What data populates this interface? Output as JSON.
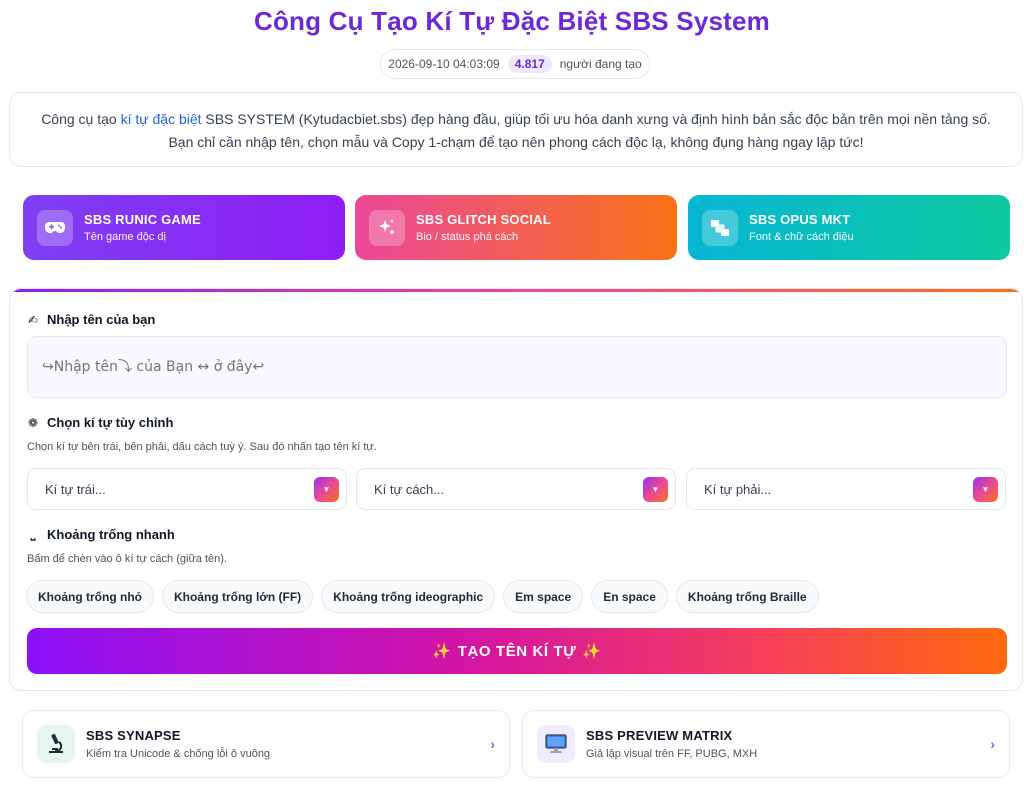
{
  "header": {
    "title": "Công Cụ Tạo Kí Tự Đặc Biệt SBS System",
    "timestamp": "2026-09-10 04:03:09",
    "user_count": "4.817",
    "user_suffix": "người đang tạo"
  },
  "intro": {
    "part1": "Công cụ tạo ",
    "link": "kí tự đặc biệt",
    "part2": " SBS SYSTEM (Kytudacbiet.sbs) đẹp hàng đầu, giúp tối ưu hóa danh xưng và định hình bản sắc độc bản trên mọi nền tảng số. Bạn chỉ cần nhập tên, chọn mẫu và Copy 1-chạm để tạo nên phong cách độc lạ, không đụng hàng ngay lập tức!"
  },
  "modes": [
    {
      "title": "SBS RUNIC GAME",
      "subtitle": "Tên game độc dị",
      "icon": "gamepad-icon"
    },
    {
      "title": "SBS GLITCH SOCIAL",
      "subtitle": "Bio / status phá cách",
      "icon": "sparkles-icon"
    },
    {
      "title": "SBS OPUS MKT",
      "subtitle": "Font & chữ cách điệu",
      "icon": "font-blocks-icon"
    }
  ],
  "form": {
    "name_label": "Nhập tên của bạn",
    "name_placeholder": "↪Nhập tên⤵ của Bạn ↔ ở đây↩",
    "custom_label": "Chọn kí tự tùy chỉnh",
    "custom_hint": "Chọn kí tự bên trái, bên phải, dấu cách tuỳ ý. Sau đó nhấn tạo tên kí tự.",
    "selects": [
      "Kí tự trái...",
      "Kí tự cách...",
      "Kí tự phải..."
    ],
    "space_label": "Khoảng trống nhanh",
    "space_hint": "Bấm để chèn vào ô kí tự cách (giữa tên).",
    "chips": [
      "Khoảng trống nhỏ",
      "Khoảng trống lớn (FF)",
      "Khoảng trống ideographic",
      "Em space",
      "En space",
      "Khoảng trống Braille"
    ],
    "generate_label": "TẠO TÊN KÍ TỰ"
  },
  "tools": [
    {
      "title": "SBS SYNAPSE",
      "subtitle": "Kiểm tra Unicode & chống lỗi ô vuông",
      "icon": "microscope-icon"
    },
    {
      "title": "SBS PREVIEW MATRIX",
      "subtitle": "Giả lập visual trên FF, PUBG, MXH",
      "icon": "monitor-icon"
    }
  ],
  "colors": {
    "title": "#6d28d9",
    "link": "#2563eb",
    "accent": "#8b5cf6"
  }
}
